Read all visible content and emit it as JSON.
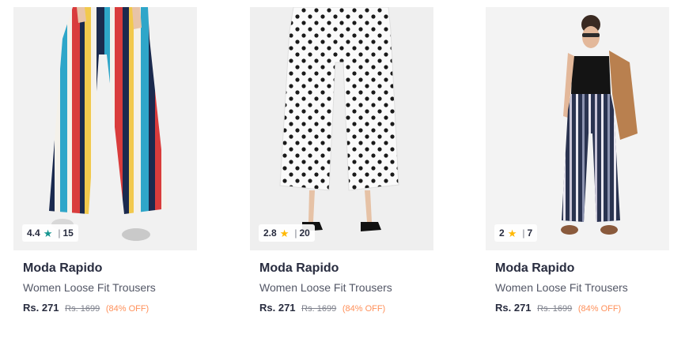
{
  "products": [
    {
      "brand": "Moda Rapido",
      "title": "Women Loose Fit Trousers",
      "rating": "4.4",
      "rating_count": "15",
      "star_color": "#14958f",
      "price": "Rs. 271",
      "mrp": "Rs. 1699",
      "discount": "(84% OFF)"
    },
    {
      "brand": "Moda Rapido",
      "title": "Women Loose Fit Trousers",
      "rating": "2.8",
      "rating_count": "20",
      "star_color": "#ffb800",
      "price": "Rs. 271",
      "mrp": "Rs. 1699",
      "discount": "(84% OFF)"
    },
    {
      "brand": "Moda Rapido",
      "title": "Women Loose Fit Trousers",
      "rating": "2",
      "rating_count": "7",
      "star_color": "#ffb800",
      "price": "Rs. 271",
      "mrp": "Rs. 1699",
      "discount": "(84% OFF)"
    }
  ],
  "icons": {
    "rating_star": "star-icon"
  },
  "colors": {
    "discount": "#ff905a",
    "brand_text": "#282c3f",
    "title_text": "#535766"
  }
}
